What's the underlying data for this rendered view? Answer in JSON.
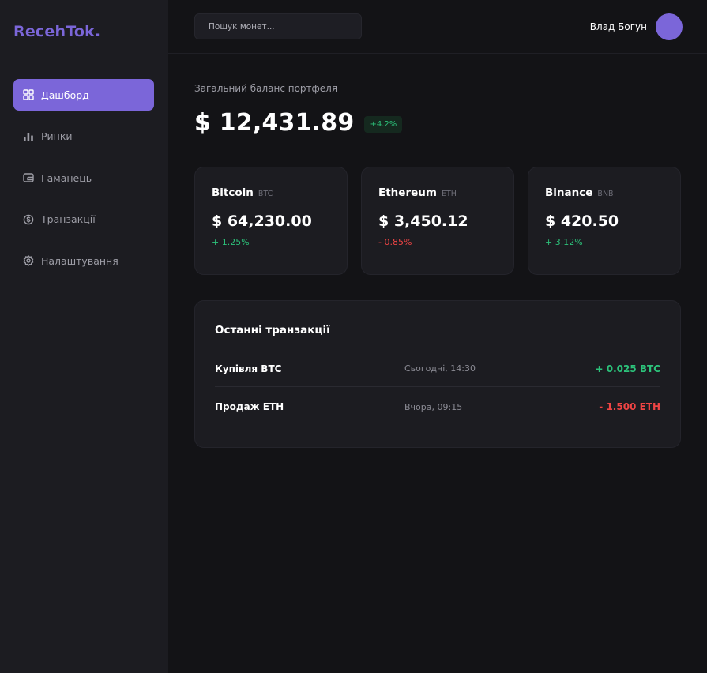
{
  "brand": {
    "logo": "RecehTok."
  },
  "sidebar": {
    "items": [
      {
        "label": "Дашборд",
        "icon": "dashboard-icon",
        "active": true
      },
      {
        "label": "Ринки",
        "icon": "bar-chart-icon",
        "active": false
      },
      {
        "label": "Гаманець",
        "icon": "wallet-icon",
        "active": false
      },
      {
        "label": "Транзакції",
        "icon": "transactions-icon",
        "active": false
      },
      {
        "label": "Налаштування",
        "icon": "settings-icon",
        "active": false
      }
    ]
  },
  "header": {
    "search_placeholder": "Пошук монет...",
    "user_name": "Влад Богун"
  },
  "portfolio": {
    "label": "Загальний баланс портфеля",
    "value": "$ 12,431.89",
    "change": "+4.2%"
  },
  "coins": [
    {
      "name": "Bitcoin",
      "symbol": "BTC",
      "price": "$ 64,230.00",
      "change": "+ 1.25%",
      "direction": "up"
    },
    {
      "name": "Ethereum",
      "symbol": "ETH",
      "price": "$ 3,450.12",
      "change": "- 0.85%",
      "direction": "down"
    },
    {
      "name": "Binance",
      "symbol": "BNB",
      "price": "$ 420.50",
      "change": "+ 3.12%",
      "direction": "up"
    }
  ],
  "transactions": {
    "title": "Останні транзакції",
    "rows": [
      {
        "name": "Купівля BTC",
        "time": "Сьогодні, 14:30",
        "amount": "+ 0.025 BTC",
        "direction": "up"
      },
      {
        "name": "Продаж ETH",
        "time": "Вчора, 09:15",
        "amount": "- 1.500 ETH",
        "direction": "down"
      }
    ]
  },
  "colors": {
    "accent": "#7b66d9",
    "background": "#131316",
    "panel": "#1c1c21",
    "positive": "#2cc27a",
    "negative": "#ef4444"
  }
}
